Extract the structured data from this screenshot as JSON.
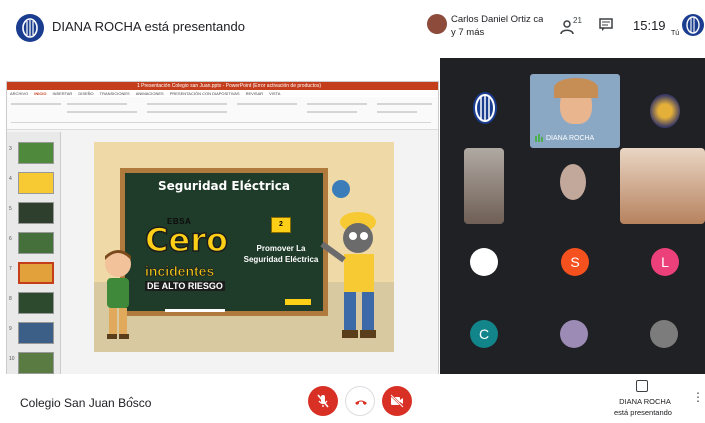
{
  "topbar": {
    "presenting_text": "DIANA ROCHA está presentando",
    "caller_name": "Carlos Daniel Ortiz cald...",
    "caller_more": "y 7 más",
    "people_count": "21",
    "clock": "15:19",
    "self_label": "Tú"
  },
  "ppt": {
    "window_title": "1 Presentación Colegio san Juan.pptx - PowerPoint (Error activación de productos)",
    "tabs": [
      "ARCHIVO",
      "INICIO",
      "INSERTAR",
      "DISEÑO",
      "TRANSICIONES",
      "ANIMACIONES",
      "PRESENTACIÓN CON DIAPOSITIVAS",
      "REVISAR",
      "VISTA"
    ],
    "active_tab": "INICIO",
    "thumb_numbers": [
      "3",
      "4",
      "5",
      "6",
      "7",
      "8",
      "9",
      "10"
    ]
  },
  "slide": {
    "board_title": "Seguridad Eléctrica",
    "brand": "EBSA",
    "cero": "Cero",
    "incidentes": "incidentes",
    "alto_riesgo": "DE ALTO RIESGO",
    "step_number": "2",
    "step_text": "Promover La Seguridad Eléctrica"
  },
  "participants": {
    "main_label": "DIANA ROCHA",
    "avatars": [
      {
        "letter": "",
        "color": "#ffffff"
      },
      {
        "letter": "S",
        "color": "#f4511e"
      },
      {
        "letter": "L",
        "color": "#ec407a"
      },
      {
        "letter": "C",
        "color": "#12858a"
      }
    ]
  },
  "bottombar": {
    "meeting_name": "Colegio San Juan Bosco",
    "present_name": "DIANA ROCHA",
    "present_status": "está presentando"
  }
}
